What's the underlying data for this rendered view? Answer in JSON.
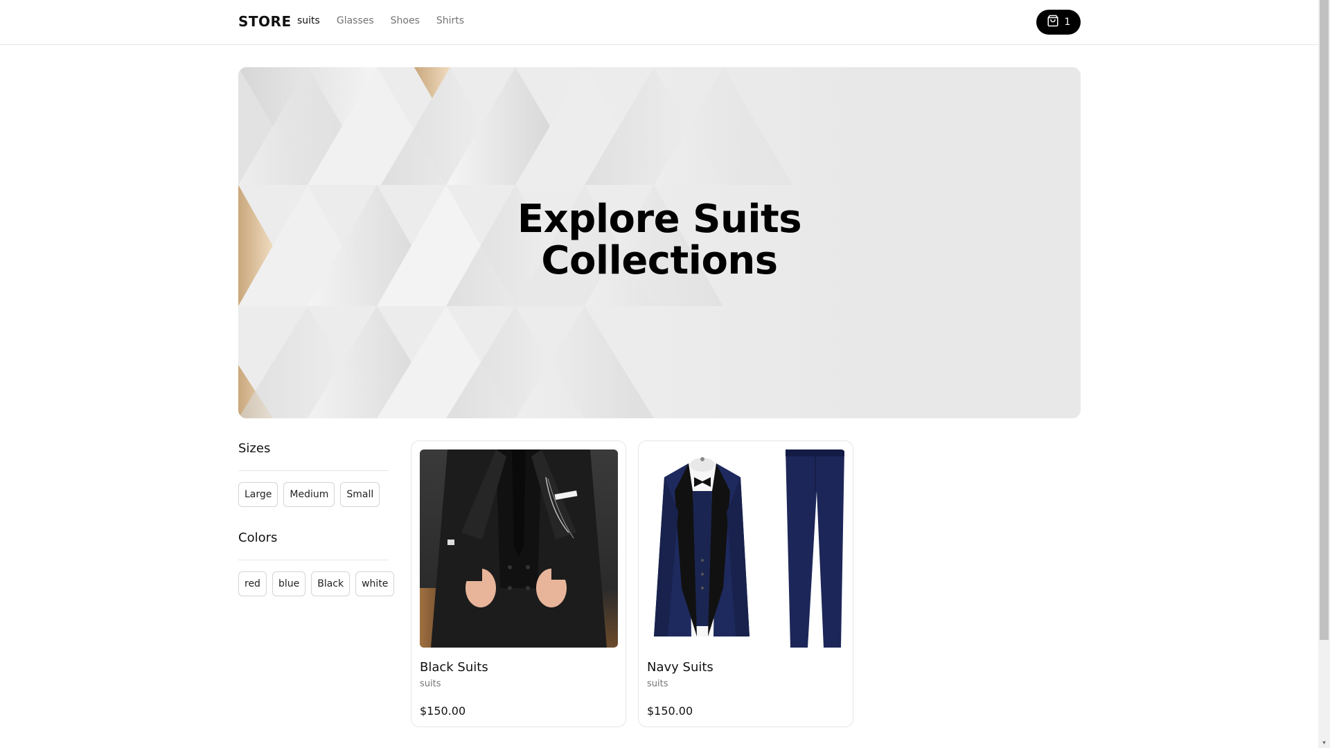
{
  "header": {
    "brand": "STORE",
    "nav": [
      {
        "label": "suits",
        "active": true
      },
      {
        "label": "Glasses",
        "active": false
      },
      {
        "label": "Shoes",
        "active": false
      },
      {
        "label": "Shirts",
        "active": false
      }
    ],
    "cart_count": "1",
    "cart_icon": "shopping-bag-icon"
  },
  "hero": {
    "title_line1": "Explore Suits",
    "title_line2": "Collections"
  },
  "filters": {
    "sizes": {
      "title": "Sizes",
      "options": [
        "Large",
        "Medium",
        "Small"
      ]
    },
    "colors": {
      "title": "Colors",
      "options": [
        "red",
        "blue",
        "Black",
        "white"
      ]
    }
  },
  "products": [
    {
      "name": "Black Suits",
      "category": "suits",
      "price": "$150.00",
      "image": "black-suit"
    },
    {
      "name": "Navy Suits",
      "category": "suits",
      "price": "$150.00",
      "image": "navy-suit"
    }
  ],
  "colors": {
    "accent": "#000000",
    "muted_text": "#737373",
    "border": "#e5e5e5",
    "hero_gold": "#e0c49a",
    "navy": "#1e2a5e"
  }
}
